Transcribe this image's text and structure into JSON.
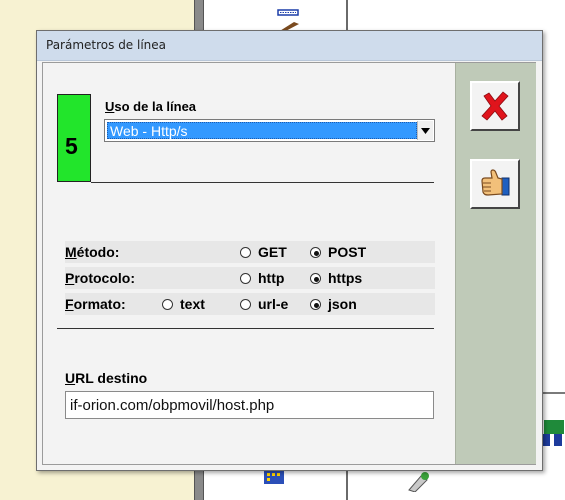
{
  "dialog": {
    "title": "Parámetros de línea",
    "line_number": "5",
    "uso": {
      "label_first": "U",
      "label_rest": "so de la línea",
      "selected": "Web - Http/s"
    },
    "metodo": {
      "label_first": "M",
      "label_rest": "étodo:",
      "options": [
        "GET",
        "POST"
      ],
      "selected": "POST"
    },
    "protocolo": {
      "label_first": "P",
      "label_rest": "rotocolo:",
      "options": [
        "http",
        "https"
      ],
      "selected": "https"
    },
    "formato": {
      "label_first": "F",
      "label_rest": "ormato:",
      "options": [
        "text",
        "url-e",
        "json"
      ],
      "selected": "json"
    },
    "url": {
      "label_first": "U",
      "label_rest": "RL destino",
      "value": "if-orion.com/obpmovil/host.php"
    }
  },
  "icons": {
    "cancel": "red-x-icon",
    "ok": "thumbs-up-icon"
  },
  "colors": {
    "line_badge": "#22e52b",
    "selection": "#3399ff",
    "sidebar": "#bfcab8",
    "cancel": "#e0141c"
  }
}
